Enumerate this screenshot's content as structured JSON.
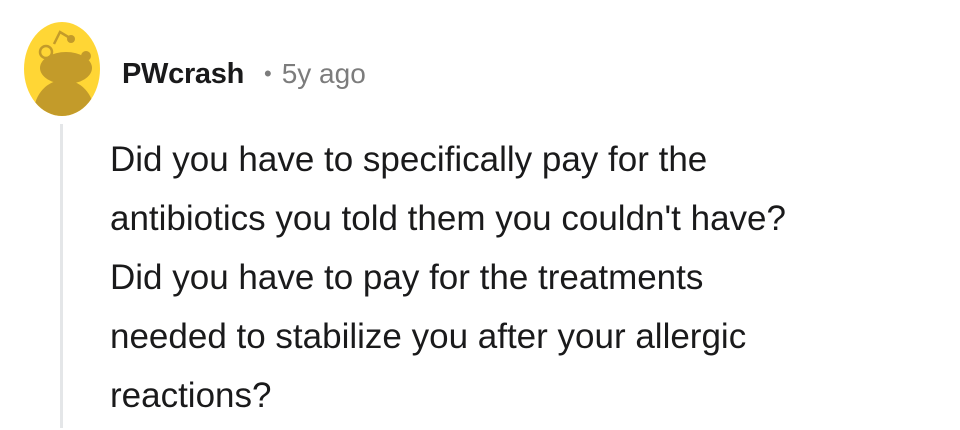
{
  "comment": {
    "author": {
      "username": "PWcrash",
      "avatar_icon": "snoo-avatar-icon",
      "avatar_color": "#FFD635"
    },
    "separator": "•",
    "timestamp": "5y ago",
    "body_lines": [
      "Did you have to specifically pay for the",
      "antibiotics you told them you couldn't have?",
      "Did you have to pay for the treatments",
      "needed to stabilize you after your allergic",
      "reactions?"
    ]
  }
}
